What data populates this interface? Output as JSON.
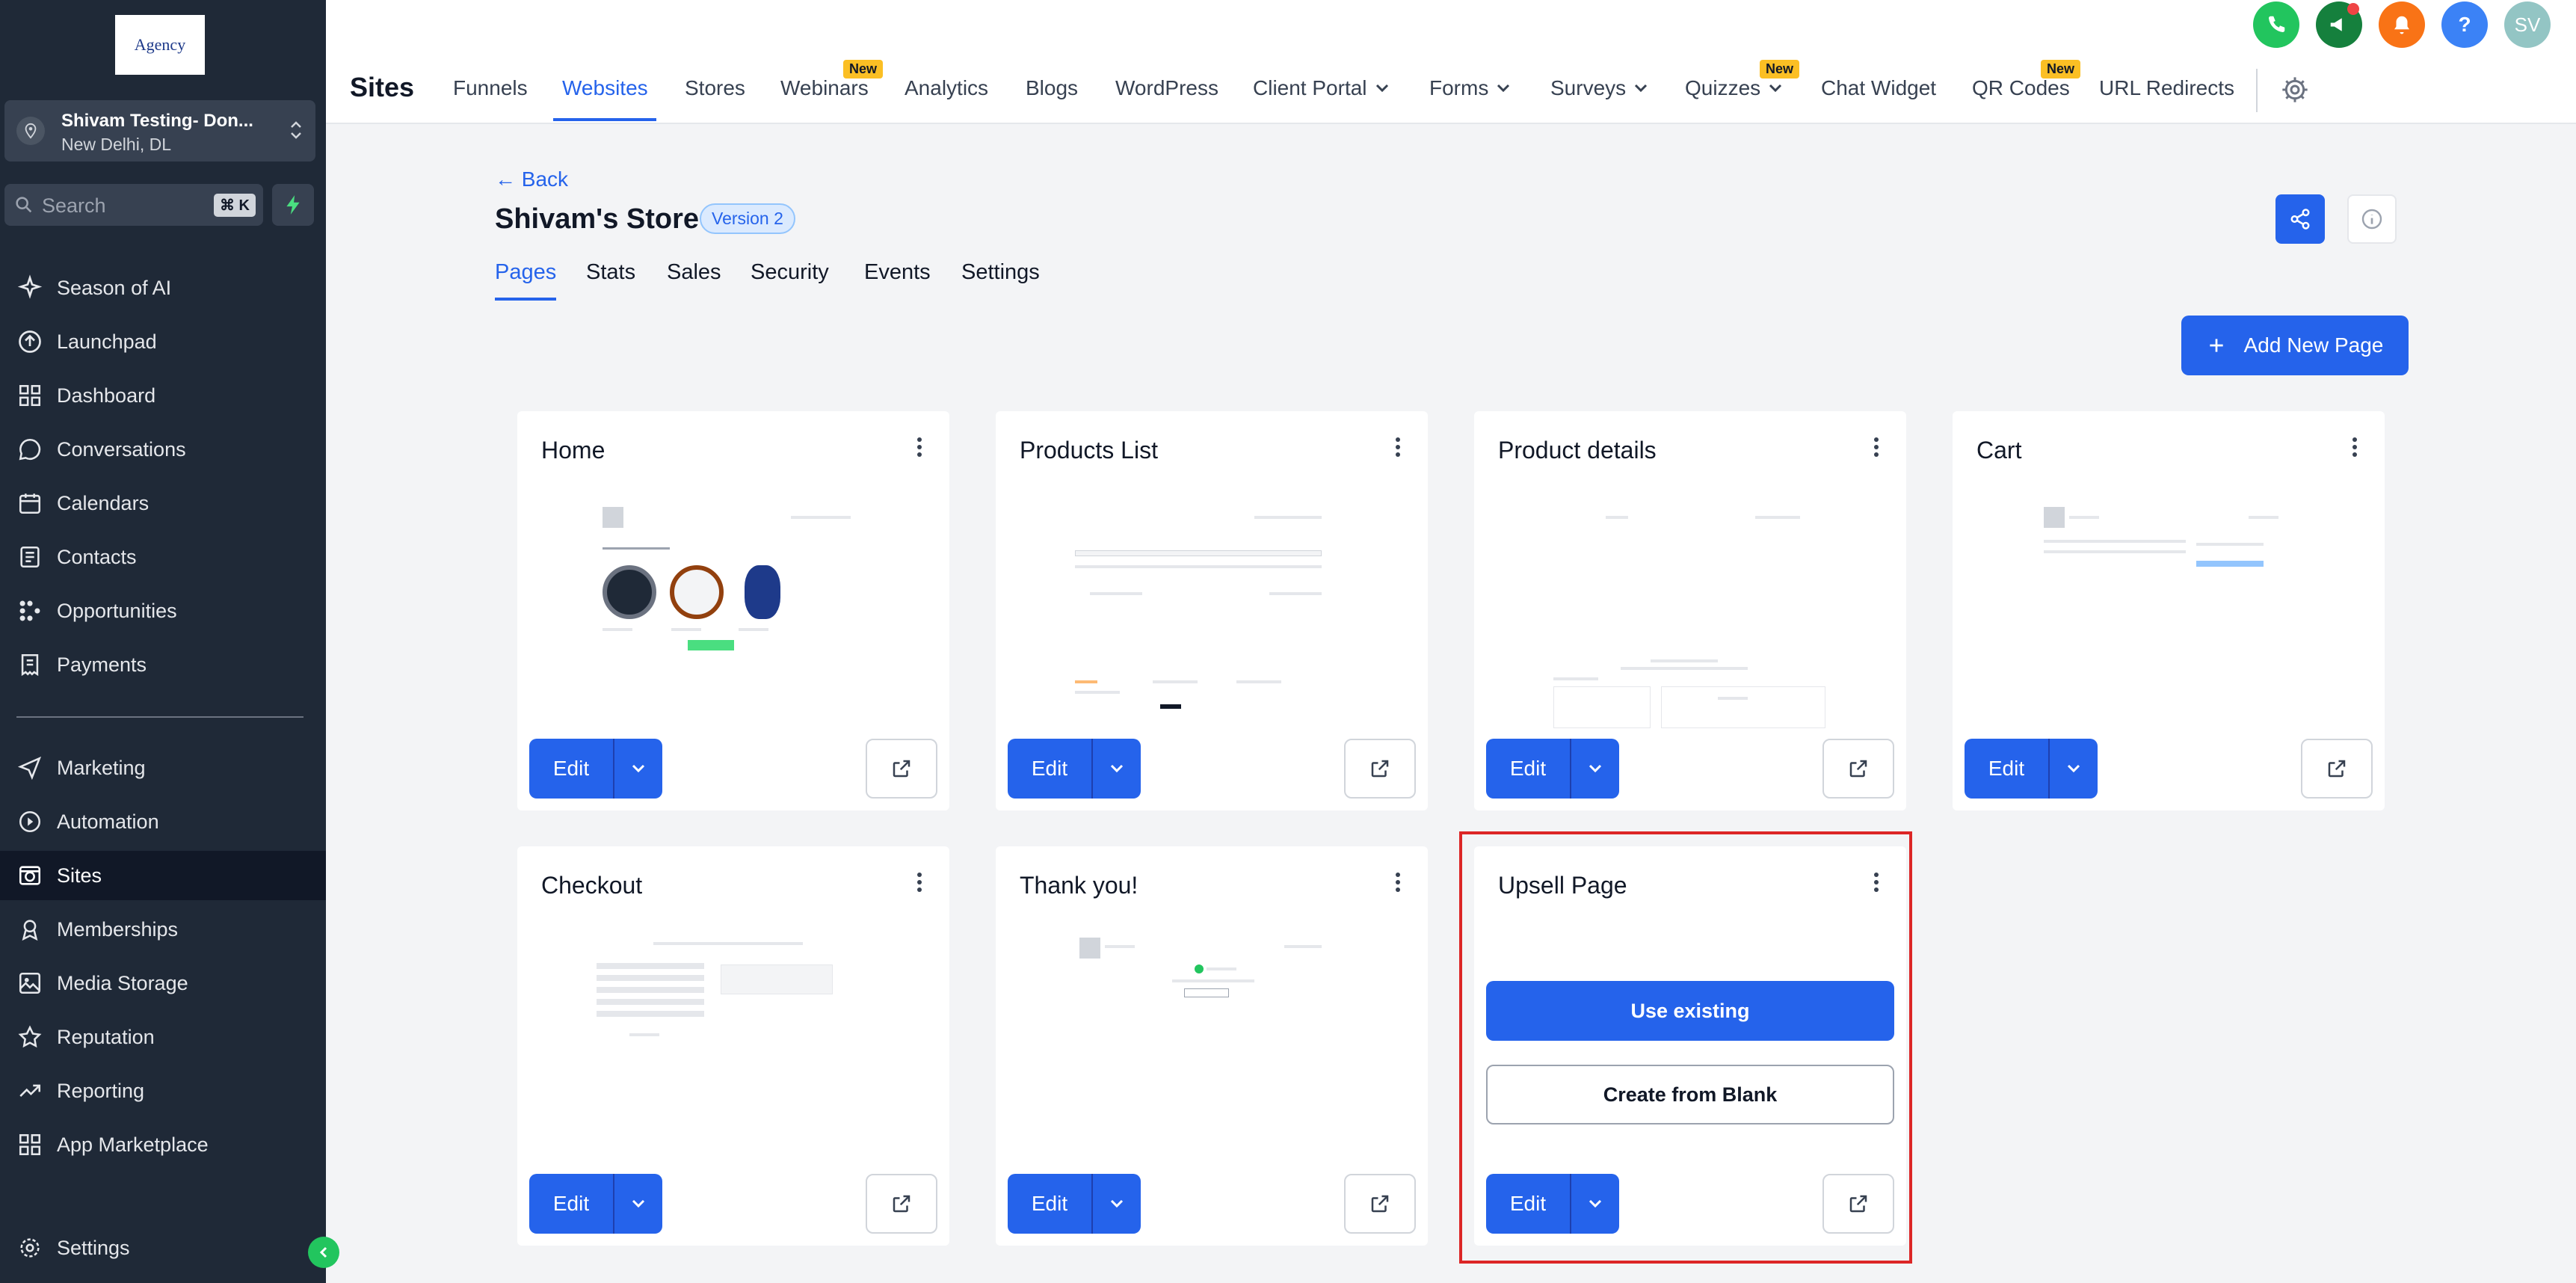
{
  "brand": {
    "logo_text": "Agency"
  },
  "account": {
    "name": "Shivam Testing- Don...",
    "location": "New Delhi, DL"
  },
  "search": {
    "placeholder": "Search",
    "shortcut": "⌘ K"
  },
  "sidebar": {
    "items": [
      {
        "label": "Season of AI",
        "icon": "sparkle-icon"
      },
      {
        "label": "Launchpad",
        "icon": "rocket-icon"
      },
      {
        "label": "Dashboard",
        "icon": "grid-icon"
      },
      {
        "label": "Conversations",
        "icon": "chat-icon"
      },
      {
        "label": "Calendars",
        "icon": "calendar-icon"
      },
      {
        "label": "Contacts",
        "icon": "contacts-icon"
      },
      {
        "label": "Opportunities",
        "icon": "pipeline-icon"
      },
      {
        "label": "Payments",
        "icon": "receipt-icon"
      },
      {
        "label": "Marketing",
        "icon": "send-icon"
      },
      {
        "label": "Automation",
        "icon": "automation-icon"
      },
      {
        "label": "Sites",
        "icon": "globe-icon"
      },
      {
        "label": "Memberships",
        "icon": "graduation-icon"
      },
      {
        "label": "Media Storage",
        "icon": "image-icon"
      },
      {
        "label": "Reputation",
        "icon": "star-icon"
      },
      {
        "label": "Reporting",
        "icon": "trending-icon"
      },
      {
        "label": "App Marketplace",
        "icon": "apps-icon"
      }
    ],
    "settings_label": "Settings",
    "active": "Sites"
  },
  "topbar": {
    "title": "Sites",
    "tabs": [
      {
        "label": "Funnels"
      },
      {
        "label": "Websites"
      },
      {
        "label": "Stores"
      },
      {
        "label": "Webinars",
        "badge": "New"
      },
      {
        "label": "Analytics"
      },
      {
        "label": "Blogs"
      },
      {
        "label": "WordPress"
      },
      {
        "label": "Client Portal"
      },
      {
        "label": "Forms"
      },
      {
        "label": "Surveys"
      },
      {
        "label": "Quizzes",
        "badge": "New"
      },
      {
        "label": "Chat Widget"
      },
      {
        "label": "QR Codes",
        "badge": "New"
      },
      {
        "label": "URL Redirects"
      }
    ],
    "active_tab": "Websites",
    "avatar_initials": "SV",
    "help_glyph": "?"
  },
  "store": {
    "back_label": "← Back",
    "name": "Shivam's Store",
    "version": "Version 2",
    "subtabs": [
      "Pages",
      "Stats",
      "Sales",
      "Security",
      "Events",
      "Settings"
    ],
    "active_subtab": "Pages",
    "add_page_label": "Add New Page"
  },
  "pages": [
    {
      "title": "Home"
    },
    {
      "title": "Products List"
    },
    {
      "title": "Product details"
    },
    {
      "title": "Cart"
    },
    {
      "title": "Checkout"
    },
    {
      "title": "Thank you!"
    },
    {
      "title": "Upsell Page",
      "use_existing_label": "Use existing",
      "create_blank_label": "Create from Blank"
    }
  ],
  "card_actions": {
    "edit_label": "Edit"
  },
  "colors": {
    "primary": "#2563eb",
    "sidebar_bg": "#1f2937",
    "highlight": "#dc2626",
    "badge": "#fbbf24"
  }
}
